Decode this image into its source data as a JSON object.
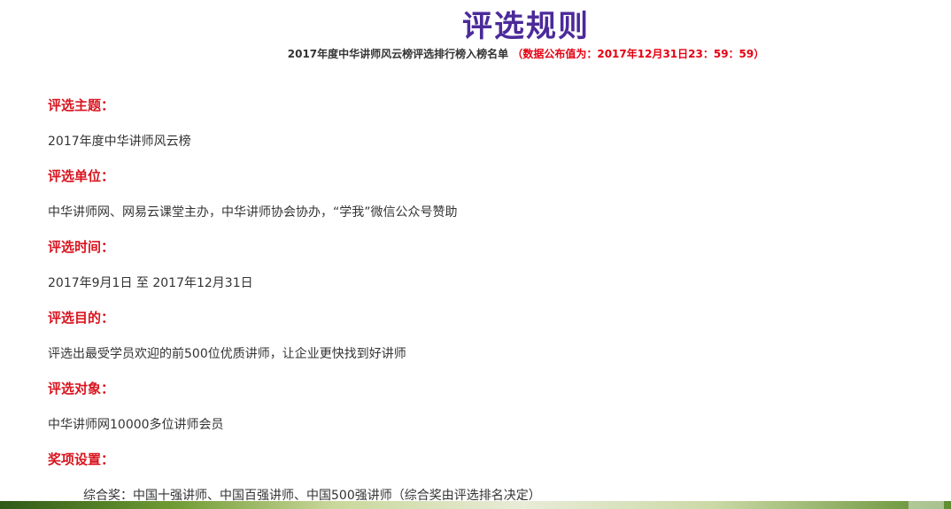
{
  "title": "评选规则",
  "subtitle": {
    "main": "2017年度中华讲师风云榜评选排行榜入榜名单",
    "notice": "（数据公布值为：2017年12月31日23：59：59）"
  },
  "sections": [
    {
      "label": "评选主题：",
      "text": "2017年度中华讲师风云榜"
    },
    {
      "label": "评选单位：",
      "text": "中华讲师网、网易云课堂主办，中华讲师协会协办，“学我”微信公众号赞助"
    },
    {
      "label": "评选时间：",
      "text": "2017年9月1日 至 2017年12月31日"
    },
    {
      "label": "评选目的：",
      "text": "评选出最受学员欢迎的前500位优质讲师，让企业更快找到好讲师"
    },
    {
      "label": "评选对象：",
      "text": "中华讲师网10000多位讲师会员"
    },
    {
      "label": "奖项设置：",
      "text": "综合奖：中国十强讲师、中国百强讲师、中国500强讲师（综合奖由评选排名决定）"
    }
  ],
  "colors": {
    "title": "#4b2a9a",
    "label": "#d9141f",
    "notice": "#e60012",
    "text": "#333333"
  }
}
